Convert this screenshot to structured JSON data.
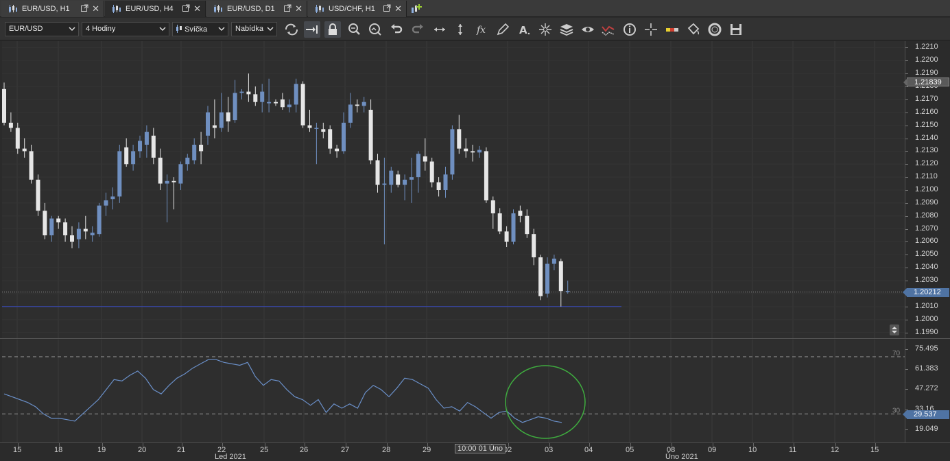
{
  "tabs": [
    {
      "label": "EUR/USD, H1",
      "active": false
    },
    {
      "label": "EUR/USD, H4",
      "active": true
    },
    {
      "label": "EUR/USD, D1",
      "active": false
    },
    {
      "label": "USD/CHF, H1",
      "active": false
    }
  ],
  "toolbar": {
    "symbol": "EUR/USD",
    "timeframe": "4 Hodiny",
    "chart_type": "Svíčka",
    "menu": "Nabídka",
    "icons": [
      "refresh-icon",
      "auto-scroll-icon",
      "lock-icon",
      "zoom-in-icon",
      "zoom-out-icon",
      "undo-icon",
      "redo-icon",
      "horizontal-arrows-icon",
      "vertical-arrows-icon",
      "fx-icon",
      "pencil-icon",
      "text-icon",
      "crosshair-star-icon",
      "layers-icon",
      "eye-icon",
      "indicator-icon",
      "info-icon",
      "cursor-icon",
      "color-bar-icon",
      "paint-bucket-icon",
      "lifebuoy-icon",
      "save-icon"
    ]
  },
  "colors": {
    "bull": "#6f8fc0",
    "bear": "#e6e6e6",
    "rsi_line": "#6a8fc8",
    "support_line": "#3a4bbf",
    "highlight_circle": "#3fae3f"
  },
  "chart_data": {
    "type": "candlestick",
    "symbol": "EUR/USD",
    "timeframe": "H4",
    "ylim": [
      1.1985,
      1.2215
    ],
    "y_ticks": [
      "1.2210",
      "1.2200",
      "1.2190",
      "1.2180",
      "1.2170",
      "1.2160",
      "1.2150",
      "1.2140",
      "1.2130",
      "1.2120",
      "1.2110",
      "1.2100",
      "1.2090",
      "1.2080",
      "1.2070",
      "1.2060",
      "1.2050",
      "1.2040",
      "1.2030",
      "1.2020",
      "1.2010",
      "1.2000",
      "1.1990"
    ],
    "current_price": "1.20212",
    "crosshair_price": "1.21839",
    "support_level": 1.201,
    "candles": [
      [
        1.2178,
        1.2183,
        1.215,
        1.2152
      ],
      [
        1.2152,
        1.216,
        1.2145,
        1.2148
      ],
      [
        1.2148,
        1.2152,
        1.2128,
        1.2132
      ],
      [
        1.2132,
        1.214,
        1.2125,
        1.213
      ],
      [
        1.213,
        1.2135,
        1.2105,
        1.2108
      ],
      [
        1.2108,
        1.2112,
        1.208,
        1.2084
      ],
      [
        1.2084,
        1.209,
        1.2062,
        1.2065
      ],
      [
        1.2065,
        1.208,
        1.206,
        1.2078
      ],
      [
        1.2078,
        1.208,
        1.207,
        1.2075
      ],
      [
        1.2075,
        1.2078,
        1.206,
        1.2065
      ],
      [
        1.2065,
        1.2072,
        1.2055,
        1.206
      ],
      [
        1.2062,
        1.2075,
        1.2055,
        1.207
      ],
      [
        1.207,
        1.208,
        1.2062,
        1.2068
      ],
      [
        1.2065,
        1.2072,
        1.206,
        1.2067
      ],
      [
        1.2066,
        1.209,
        1.2064,
        1.2088
      ],
      [
        1.2088,
        1.2098,
        1.208,
        1.2092
      ],
      [
        1.2093,
        1.2102,
        1.2085,
        1.2095
      ],
      [
        1.2095,
        1.2135,
        1.209,
        1.213
      ],
      [
        1.2133,
        1.214,
        1.2118,
        1.212
      ],
      [
        1.212,
        1.2135,
        1.2115,
        1.213
      ],
      [
        1.213,
        1.2142,
        1.2125,
        1.2138
      ],
      [
        1.2135,
        1.215,
        1.2125,
        1.2145
      ],
      [
        1.2142,
        1.2148,
        1.212,
        1.2125
      ],
      [
        1.2125,
        1.2132,
        1.21,
        1.2105
      ],
      [
        1.2105,
        1.2112,
        1.2075,
        1.2107
      ],
      [
        1.2107,
        1.211,
        1.2085,
        1.2106
      ],
      [
        1.2105,
        1.2122,
        1.21,
        1.212
      ],
      [
        1.212,
        1.2128,
        1.2115,
        1.2125
      ],
      [
        1.2123,
        1.214,
        1.212,
        1.2135
      ],
      [
        1.2135,
        1.2145,
        1.212,
        1.213
      ],
      [
        1.2142,
        1.2165,
        1.2135,
        1.216
      ],
      [
        1.215,
        1.217,
        1.214,
        1.2148
      ],
      [
        1.2148,
        1.2175,
        1.2145,
        1.216
      ],
      [
        1.216,
        1.2172,
        1.2145,
        1.2153
      ],
      [
        1.2154,
        1.2185,
        1.2152,
        1.2175
      ],
      [
        1.2175,
        1.2178,
        1.217,
        1.2176
      ],
      [
        1.2176,
        1.219,
        1.2168,
        1.2174
      ],
      [
        1.2174,
        1.218,
        1.2165,
        1.2168
      ],
      [
        1.2168,
        1.2182,
        1.216,
        1.2176
      ],
      [
        1.2167,
        1.2186,
        1.216,
        1.2168
      ],
      [
        1.2168,
        1.217,
        1.2165,
        1.2167
      ],
      [
        1.217,
        1.2175,
        1.2162,
        1.2164
      ],
      [
        1.2164,
        1.217,
        1.216,
        1.2166
      ],
      [
        1.2166,
        1.2186,
        1.216,
        1.2182
      ],
      [
        1.2182,
        1.2184,
        1.2148,
        1.215
      ],
      [
        1.215,
        1.2162,
        1.2145,
        1.2148
      ],
      [
        1.2148,
        1.2152,
        1.212,
        1.2148
      ],
      [
        1.2147,
        1.2152,
        1.214,
        1.2145
      ],
      [
        1.2147,
        1.215,
        1.2128,
        1.2132
      ],
      [
        1.2132,
        1.2135,
        1.2125,
        1.213
      ],
      [
        1.213,
        1.216,
        1.2128,
        1.2152
      ],
      [
        1.2152,
        1.2175,
        1.2148,
        1.2166
      ],
      [
        1.2166,
        1.217,
        1.216,
        1.2165
      ],
      [
        1.2165,
        1.2172,
        1.216,
        1.2168
      ],
      [
        1.2162,
        1.217,
        1.212,
        1.2123
      ],
      [
        1.2123,
        1.2128,
        1.2098,
        1.2104
      ],
      [
        1.2104,
        1.2125,
        1.2058,
        1.2105
      ],
      [
        1.2104,
        1.2118,
        1.2098,
        1.2115
      ],
      [
        1.2112,
        1.2115,
        1.2102,
        1.2104
      ],
      [
        1.2104,
        1.2112,
        1.2092,
        1.2108
      ],
      [
        1.2108,
        1.2125,
        1.209,
        1.211
      ],
      [
        1.211,
        1.213,
        1.2098,
        1.2128
      ],
      [
        1.2126,
        1.214,
        1.2115,
        1.2122
      ],
      [
        1.2122,
        1.2125,
        1.2102,
        1.2106
      ],
      [
        1.2106,
        1.211,
        1.2095,
        1.21
      ],
      [
        1.21,
        1.2118,
        1.2094,
        1.2112
      ],
      [
        1.2112,
        1.215,
        1.2108,
        1.2147
      ],
      [
        1.2147,
        1.2158,
        1.2128,
        1.2132
      ],
      [
        1.2132,
        1.214,
        1.2125,
        1.213
      ],
      [
        1.213,
        1.2135,
        1.2122,
        1.2129
      ],
      [
        1.2129,
        1.2134,
        1.2125,
        1.2131
      ],
      [
        1.213,
        1.2133,
        1.209,
        1.2092
      ],
      [
        1.2092,
        1.2095,
        1.207,
        1.2082
      ],
      [
        1.2082,
        1.2086,
        1.2066,
        1.2068
      ],
      [
        1.2068,
        1.2072,
        1.2056,
        1.206
      ],
      [
        1.206,
        1.2085,
        1.2058,
        1.2082
      ],
      [
        1.2084,
        1.2088,
        1.2075,
        1.208
      ],
      [
        1.208,
        1.2085,
        1.2063,
        1.2066
      ],
      [
        1.2066,
        1.207,
        1.2042,
        1.2048
      ],
      [
        1.2048,
        1.205,
        1.2015,
        1.2018
      ],
      [
        1.202,
        1.2048,
        1.2017,
        1.2043
      ],
      [
        1.2043,
        1.205,
        1.2038,
        1.2047
      ],
      [
        1.2045,
        1.2047,
        1.201,
        1.2022
      ],
      [
        1.2022,
        1.203,
        1.202,
        1.2022
      ]
    ],
    "rsi": {
      "name": "RSI",
      "levels": [
        70,
        30
      ],
      "ylim": [
        10,
        82
      ],
      "y_ticks": [
        "75.495",
        "61.383",
        "47.272",
        "33.16",
        "19.049"
      ],
      "current": "29.537",
      "values": [
        44,
        42,
        40,
        38,
        35,
        30,
        27,
        27,
        26,
        25,
        30,
        35,
        40,
        47,
        54,
        53,
        57,
        60,
        55,
        47,
        44,
        50,
        55,
        58,
        62,
        65,
        68,
        68,
        66,
        65,
        64,
        66,
        56,
        50,
        54,
        53,
        47,
        42,
        40,
        36,
        40,
        31,
        37,
        34,
        37,
        34,
        45,
        50,
        47,
        42,
        48,
        55,
        54,
        51,
        48,
        40,
        34,
        35,
        32,
        38,
        35,
        31,
        27,
        31,
        32,
        27,
        24,
        26,
        28,
        27,
        25,
        24
      ]
    },
    "x_ticks": [
      "15",
      "18",
      "19",
      "20",
      "21",
      "22",
      "25",
      "26",
      "27",
      "28",
      "29",
      "02",
      "03",
      "04",
      "05",
      "08",
      "09",
      "10",
      "11",
      "12",
      "15"
    ],
    "months": [
      "Led 2021",
      "Úno 2021"
    ],
    "cursor_time": "10:00 01 Úno"
  }
}
